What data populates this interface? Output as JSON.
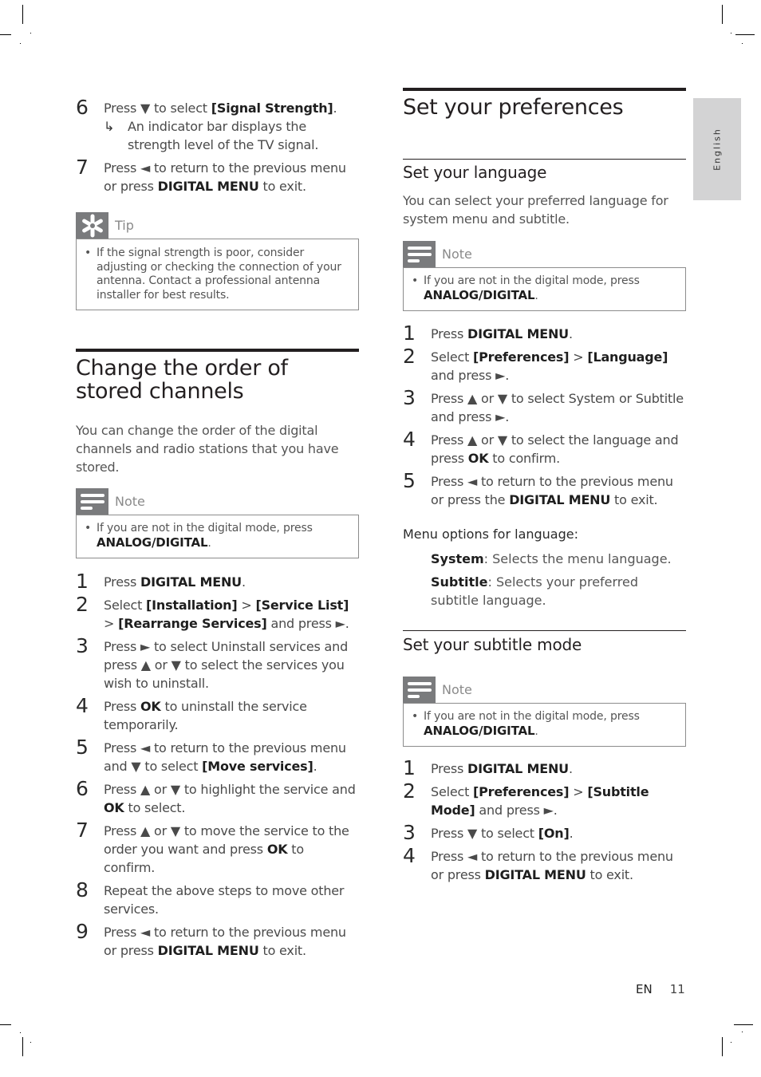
{
  "side_tab": {
    "label": "English"
  },
  "left": {
    "top_steps": [
      {
        "num": "6",
        "segments": [
          [
            "t",
            "Press ▼ to select "
          ],
          [
            "b",
            "[Signal Strength]"
          ],
          [
            "t",
            "."
          ]
        ],
        "result": "An indicator bar displays the strength level of the TV signal."
      },
      {
        "num": "7",
        "segments": [
          [
            "t",
            "Press ◄ to return to the previous menu or press "
          ],
          [
            "b",
            "DIGITAL MENU"
          ],
          [
            "t",
            " to exit."
          ]
        ]
      }
    ],
    "tip": {
      "icon": "tip-asterisk-icon",
      "label": "Tip",
      "items": [
        [
          [
            "t",
            "If the signal strength is poor, consider adjusting or checking the connection of your antenna. Contact a professional antenna installer for best results."
          ]
        ]
      ]
    },
    "section": {
      "title": "Change the order of stored channels",
      "intro": "You can change the order of the digital channels and radio stations that you have stored.",
      "note": {
        "icon": "note-lines-icon",
        "label": "Note",
        "items": [
          [
            [
              "t",
              "If you are not in the digital mode, press "
            ],
            [
              "b",
              "ANALOG/DIGITAL"
            ],
            [
              "t",
              "."
            ]
          ]
        ]
      },
      "steps": [
        {
          "num": "1",
          "segments": [
            [
              "t",
              "Press "
            ],
            [
              "b",
              "DIGITAL MENU"
            ],
            [
              "t",
              "."
            ]
          ]
        },
        {
          "num": "2",
          "segments": [
            [
              "t",
              "Select "
            ],
            [
              "b",
              "[Installation]"
            ],
            [
              "t",
              " > "
            ],
            [
              "b",
              "[Service List]"
            ],
            [
              "t",
              " > "
            ],
            [
              "b",
              "[Rearrange Services]"
            ],
            [
              "t",
              " and press ►."
            ]
          ]
        },
        {
          "num": "3",
          "segments": [
            [
              "t",
              "Press ► to select Uninstall services and press ▲ or ▼ to select the services you wish to uninstall."
            ]
          ]
        },
        {
          "num": "4",
          "segments": [
            [
              "t",
              "Press "
            ],
            [
              "b",
              "OK"
            ],
            [
              "t",
              " to uninstall the service temporarily."
            ]
          ]
        },
        {
          "num": "5",
          "segments": [
            [
              "t",
              "Press ◄ to return to the previous menu and ▼ to select "
            ],
            [
              "b",
              "[Move services]"
            ],
            [
              "t",
              "."
            ]
          ]
        },
        {
          "num": "6",
          "segments": [
            [
              "t",
              "Press ▲ or ▼ to highlight the service and "
            ],
            [
              "b",
              "OK"
            ],
            [
              "t",
              " to select."
            ]
          ]
        },
        {
          "num": "7",
          "segments": [
            [
              "t",
              "Press ▲ or ▼ to move the service to the order you want and press "
            ],
            [
              "b",
              "OK"
            ],
            [
              "t",
              " to confirm."
            ]
          ]
        },
        {
          "num": "8",
          "segments": [
            [
              "t",
              "Repeat the above steps to move other services."
            ]
          ]
        },
        {
          "num": "9",
          "segments": [
            [
              "t",
              "Press ◄ to return to the previous menu or press "
            ],
            [
              "b",
              "DIGITAL MENU"
            ],
            [
              "t",
              " to exit."
            ]
          ]
        }
      ]
    }
  },
  "right": {
    "title": "Set your preferences",
    "language": {
      "title": "Set your language",
      "intro": "You can select your preferred language for system menu and subtitle.",
      "note": {
        "icon": "note-lines-icon",
        "label": "Note",
        "items": [
          [
            [
              "t",
              "If you are not in the digital mode, press "
            ],
            [
              "b",
              "ANALOG/DIGITAL"
            ],
            [
              "t",
              "."
            ]
          ]
        ]
      },
      "steps": [
        {
          "num": "1",
          "segments": [
            [
              "t",
              "Press "
            ],
            [
              "b",
              "DIGITAL MENU"
            ],
            [
              "t",
              "."
            ]
          ]
        },
        {
          "num": "2",
          "segments": [
            [
              "t",
              "Select "
            ],
            [
              "b",
              "[Preferences]"
            ],
            [
              "t",
              " > "
            ],
            [
              "b",
              "[Language]"
            ],
            [
              "t",
              " and press ►."
            ]
          ]
        },
        {
          "num": "3",
          "segments": [
            [
              "t",
              "Press ▲ or ▼ to select System or Subtitle and press ►."
            ]
          ]
        },
        {
          "num": "4",
          "segments": [
            [
              "t",
              "Press ▲ or ▼ to select the language and press "
            ],
            [
              "b",
              "OK"
            ],
            [
              "t",
              " to confirm."
            ]
          ]
        },
        {
          "num": "5",
          "segments": [
            [
              "t",
              "Press ◄ to return to the previous menu or press the  "
            ],
            [
              "b",
              "DIGITAL MENU"
            ],
            [
              "t",
              " to exit."
            ]
          ]
        }
      ],
      "options_title": "Menu options for language:",
      "options": [
        {
          "name": "System",
          "desc": ": Selects the menu language."
        },
        {
          "name": "Subtitle",
          "desc": ": Selects your preferred subtitle language."
        }
      ]
    },
    "subtitle": {
      "title": "Set your subtitle mode",
      "note": {
        "icon": "note-lines-icon",
        "label": "Note",
        "items": [
          [
            [
              "t",
              "If you are not in the digital mode, press "
            ],
            [
              "b",
              "ANALOG/DIGITAL"
            ],
            [
              "t",
              "."
            ]
          ]
        ]
      },
      "steps": [
        {
          "num": "1",
          "segments": [
            [
              "t",
              "Press "
            ],
            [
              "b",
              "DIGITAL MENU"
            ],
            [
              "t",
              "."
            ]
          ]
        },
        {
          "num": "2",
          "segments": [
            [
              "t",
              "Select "
            ],
            [
              "b",
              "[Preferences]"
            ],
            [
              "t",
              " > "
            ],
            [
              "b",
              "[Subtitle Mode]"
            ],
            [
              "t",
              " and press ►."
            ]
          ]
        },
        {
          "num": "3",
          "segments": [
            [
              "t",
              "Press ▼ to select "
            ],
            [
              "b",
              "[On]"
            ],
            [
              "t",
              "."
            ]
          ]
        },
        {
          "num": "4",
          "segments": [
            [
              "t",
              "Press ◄ to return to the previous menu or press "
            ],
            [
              "b",
              "DIGITAL MENU"
            ],
            [
              "t",
              " to exit."
            ]
          ]
        }
      ]
    }
  },
  "footer": {
    "lang": "EN",
    "page": "11"
  }
}
